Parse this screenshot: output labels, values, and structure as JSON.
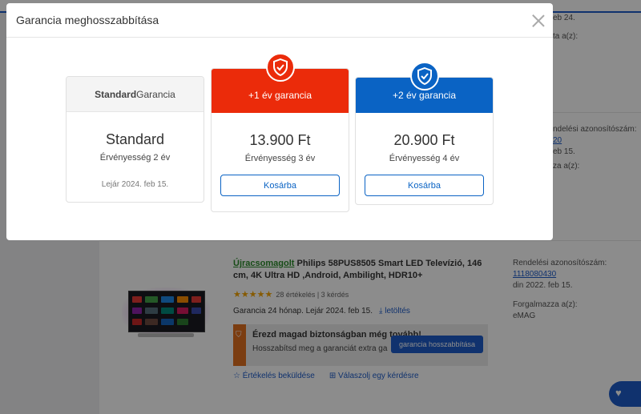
{
  "background": {
    "right_col_top": [
      "eb 24.",
      "ta a(z):"
    ],
    "right_col_mid": [
      "ndelési azonosítószám:",
      "20",
      "eb 15.",
      "za a(z):"
    ],
    "order": {
      "id_label": "Rendelési azonosítószám:",
      "id_value": "1118080430",
      "date": "din 2022. feb 15.",
      "seller_label": "Forgalmazza a(z):",
      "seller_value": "eMAG"
    },
    "product": {
      "refurb_label": "Újracsomagolt",
      "title": " Philips 58PUS8505 Smart LED Televízió, 146 cm, 4K Ultra HD ,Android, Ambilight, HDR10+",
      "stars": "★★★★★",
      "reviews": "28 értékelés | 3 kérdés",
      "warranty": "Garancia 24 hónap. Lejár 2024. feb 15.",
      "download": "letöltés",
      "promo_title": "Érezd magad biztonságban még tovább!",
      "promo_text": "Hosszabítsd meg a garanciát extra ga",
      "promo_button": "garancia hosszabbítása",
      "link_review": "Értékelés beküldése",
      "link_question": "Válaszolj egy kérdésre"
    }
  },
  "modal": {
    "title": "Garancia meghosszabbítása",
    "options": [
      {
        "head_bold": "Standard",
        "head_rest": " Garancia",
        "price": "Standard",
        "validity": "Érvényesség 2 év",
        "expires": "Lejár 2024. feb 15."
      },
      {
        "head": "+1 év garancia",
        "price": "13.900 Ft",
        "validity": "Érvényesség 3 év",
        "button": "Kosárba",
        "color": "#eb2b0a"
      },
      {
        "head": "+2 év garancia",
        "price": "20.900 Ft",
        "validity": "Érvényesség 4 év",
        "button": "Kosárba",
        "color": "#0a63c4"
      }
    ]
  },
  "icons": [
    "shield-check-icon",
    "close-icon",
    "download-icon",
    "star-icon",
    "chat-icon"
  ]
}
